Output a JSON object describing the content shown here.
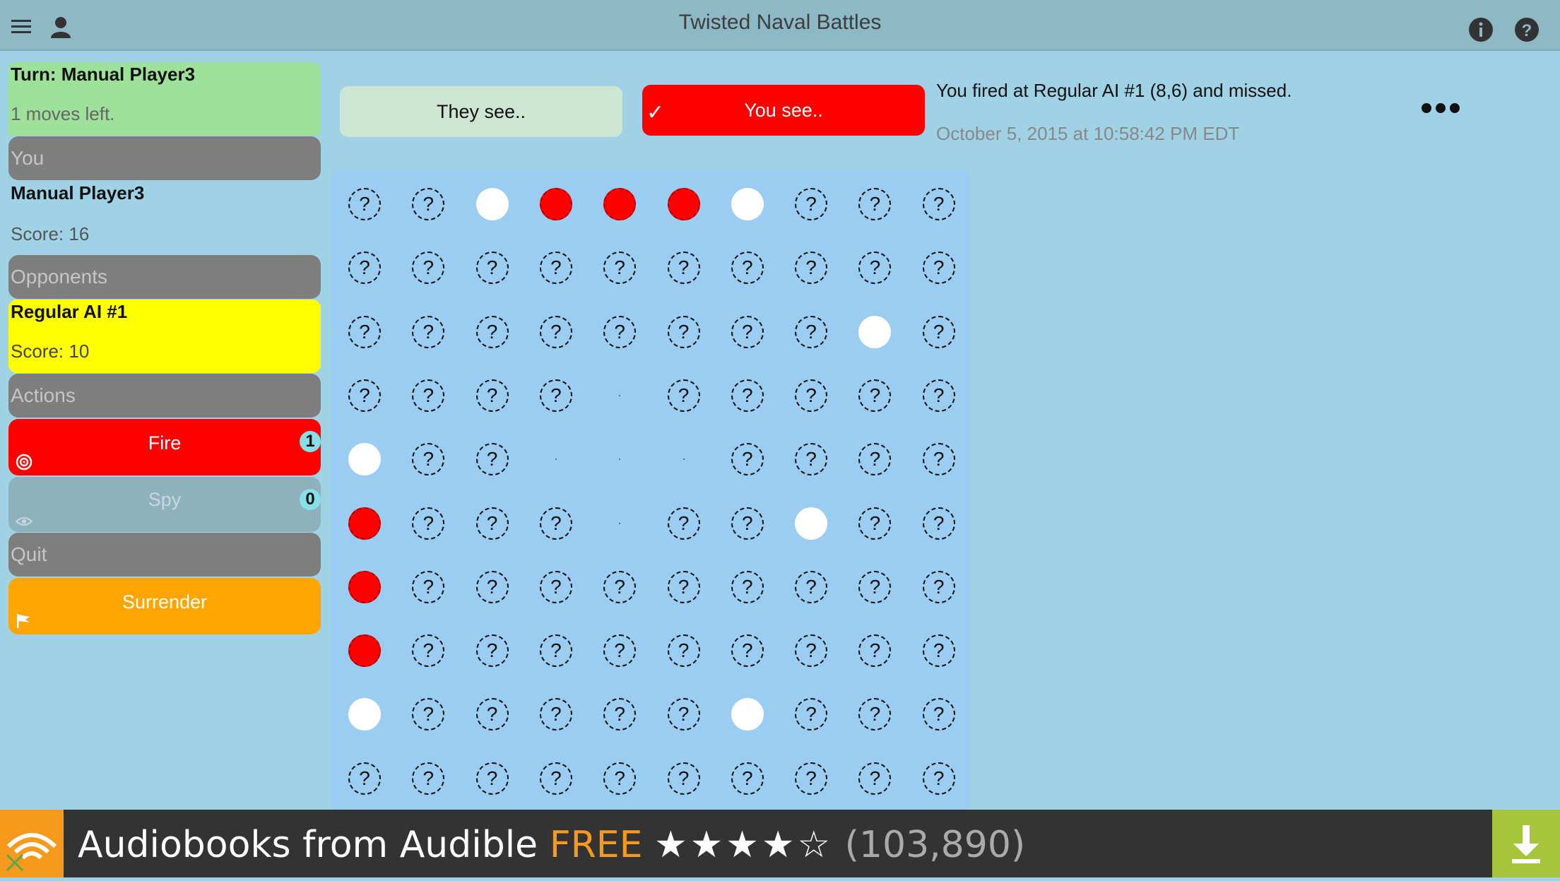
{
  "app": {
    "title": "Twisted Naval Battles"
  },
  "turn": {
    "title": "Turn: Manual Player3",
    "moves": "1 moves left."
  },
  "you": {
    "header": "You",
    "name": "Manual Player3",
    "score": "Score: 16"
  },
  "opponents": {
    "header": "Opponents",
    "name": "Regular AI #1",
    "score": "Score: 10"
  },
  "actions": {
    "header": "Actions",
    "fire": {
      "label": "Fire",
      "count": "1"
    },
    "spy": {
      "label": "Spy",
      "count": "0"
    },
    "quit_header": "Quit",
    "surrender": {
      "label": "Surrender"
    }
  },
  "tabs": {
    "they_see": "They see..",
    "you_see": "You see..",
    "active": "you_see"
  },
  "log": {
    "message": "You fired at Regular AI #1 (8,6) and missed.",
    "timestamp": "October 5, 2015 at 10:58:42 PM EDT"
  },
  "board": {
    "unknown_glyph": "?",
    "rows": [
      [
        "?",
        "?",
        "M",
        "H",
        "H",
        "H",
        "M",
        "?",
        "?",
        "?"
      ],
      [
        "?",
        "?",
        "?",
        "?",
        "?",
        "?",
        "?",
        "?",
        "?",
        "?"
      ],
      [
        "?",
        "?",
        "?",
        "?",
        "?",
        "?",
        "?",
        "?",
        "M",
        "?"
      ],
      [
        "?",
        "?",
        "?",
        "?",
        ".",
        "?",
        "?",
        "?",
        "?",
        "?"
      ],
      [
        "M",
        "?",
        "?",
        ".",
        ".",
        ".",
        "?",
        "?",
        "?",
        "?"
      ],
      [
        "H",
        "?",
        "?",
        "?",
        ".",
        "?",
        "?",
        "M",
        "?",
        "?"
      ],
      [
        "H",
        "?",
        "?",
        "?",
        "?",
        "?",
        "?",
        "?",
        "?",
        "?"
      ],
      [
        "H",
        "?",
        "?",
        "?",
        "?",
        "?",
        "?",
        "?",
        "?",
        "?"
      ],
      [
        "M",
        "?",
        "?",
        "?",
        "?",
        "?",
        "M",
        "?",
        "?",
        "?"
      ],
      [
        "?",
        "?",
        "?",
        "?",
        "?",
        "?",
        "?",
        "?",
        "?",
        "?"
      ]
    ]
  },
  "ad": {
    "title": "Audiobooks from Audible",
    "price": "FREE",
    "stars": "★★★★☆",
    "rating_count": "(103,890)"
  },
  "colors": {
    "hit": "#ff0000",
    "miss": "#ffffff",
    "board": "#9bcdf2",
    "header": "#8db8c6"
  }
}
